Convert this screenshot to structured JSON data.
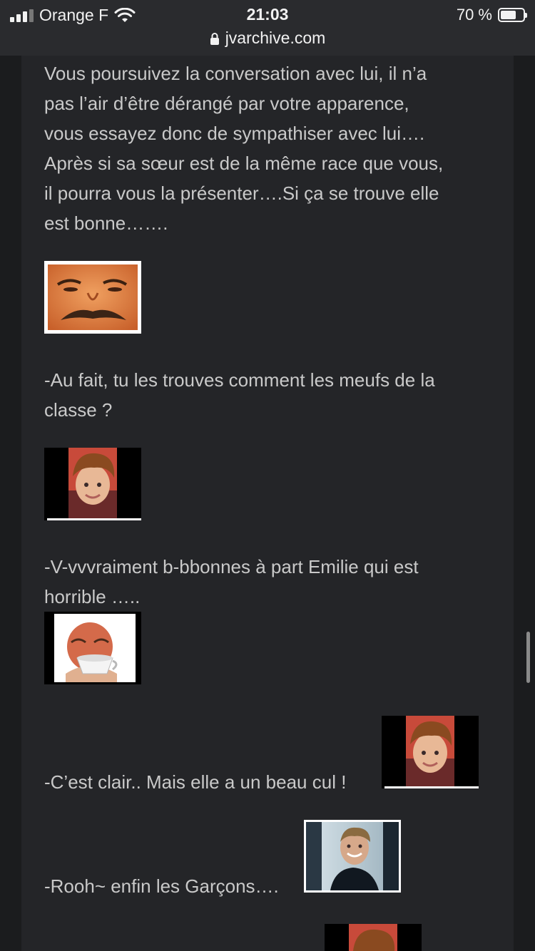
{
  "status_bar": {
    "carrier": "Orange F",
    "time": "21:03",
    "battery_text": "70 %",
    "battery_level": 0.7,
    "signal_bars": 3
  },
  "address_bar": {
    "url": "jvarchive.com"
  },
  "post": {
    "paragraph1": [
      "Vous poursuivez la conversation avec lui, il n’a",
      "pas l’air d’être dérangé par votre apparence,",
      "vous essayez donc de sympathiser avec lui….",
      "Après si sa sœur est de la même race que vous,",
      "il pourra vous la présenter….Si ça se trouve elle",
      "est bonne……."
    ],
    "line_question": [
      "-Au fait, tu les trouves comment les meufs de la",
      "classe ?"
    ],
    "line_answer": [
      "-V-vvvraiment b-bbonnes à part Emilie qui est",
      "horrible ….."
    ],
    "line_clair": "-C’est clair.. Mais elle a un beau cul !",
    "line_rooh": "-Rooh~ enfin les Garçons…."
  },
  "stickers": {
    "risitas_face": "risitas-face-sticker",
    "bieber_1": "bieber-sticker",
    "risitas_tea": "risitas-tea-sticker",
    "bieber_2": "bieber-sticker",
    "guy_photo": "smiling-man-sticker",
    "bieber_3": "bieber-sticker"
  },
  "colors": {
    "background": "#1b1c1e",
    "column": "#242528",
    "text": "#c9c9c9",
    "status_bar": "#2a2b2e"
  }
}
